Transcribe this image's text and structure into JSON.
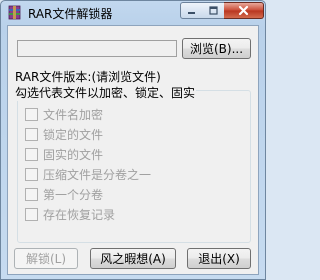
{
  "window": {
    "title": "RAR文件解锁器",
    "icon": "rar-archive-icon",
    "controls": {
      "minimize": "minimize-icon",
      "maximize": "maximize-icon",
      "close": "close-icon"
    }
  },
  "path": {
    "value": "",
    "browse_label": "浏览(B)..."
  },
  "version": {
    "label": "RAR文件版本:(请浏览文件)"
  },
  "options": {
    "group_title": "勾选代表文件以加密、锁定、固实",
    "items": [
      {
        "label": "文件名加密",
        "checked": false,
        "enabled": false
      },
      {
        "label": "锁定的文件",
        "checked": false,
        "enabled": false
      },
      {
        "label": "固实的文件",
        "checked": false,
        "enabled": false
      },
      {
        "label": "压缩文件是分卷之一",
        "checked": false,
        "enabled": false
      },
      {
        "label": "第一个分卷",
        "checked": false,
        "enabled": false
      },
      {
        "label": "存在恢复记录",
        "checked": false,
        "enabled": false
      }
    ]
  },
  "buttons": {
    "unlock": "解锁(L)",
    "theme": "风之暇想(A)",
    "exit": "退出(X)"
  },
  "colors": {
    "titlebar": "#b9d1ea",
    "close": "#c94a34",
    "dialog": "#f0f0f0",
    "disabled_text": "#a0a0a0"
  }
}
